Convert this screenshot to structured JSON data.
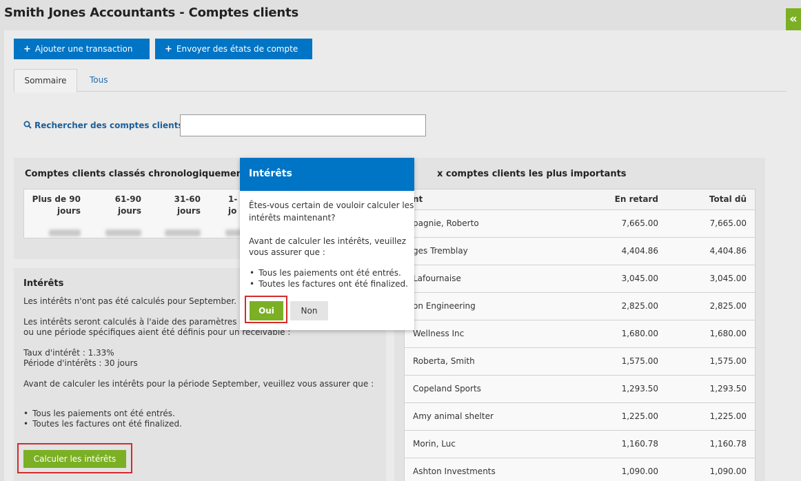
{
  "header": {
    "title": "Smith Jones Accountants - Comptes clients",
    "collapse_icon": "«"
  },
  "toolbar": {
    "add_label": "Ajouter une transaction",
    "send_label": "Envoyer des états de compte",
    "plus": "+"
  },
  "tabs": [
    {
      "label": "Sommaire",
      "active": true
    },
    {
      "label": "Tous",
      "active": false
    }
  ],
  "search": {
    "label": "Rechercher des comptes clients",
    "value": ""
  },
  "aging": {
    "title": "Comptes clients classés chronologiquement",
    "columns": [
      {
        "line1": "Plus de 90",
        "line2": "jours"
      },
      {
        "line1": "61-90",
        "line2": "jours"
      },
      {
        "line1": "31-60",
        "line2": "jours"
      },
      {
        "line1": "1-",
        "line2": "jo"
      }
    ]
  },
  "interest": {
    "title": "Intérêts",
    "line1": "Les intérêts n'ont pas été calculés pour September.",
    "line2": "Les intérêts seront calculés à l'aide des paramètres p",
    "line3": "ou une période spécifiques aient été définis pour un receivable :",
    "rate": "Taux d'intérêt : 1.33%",
    "period": "Période d'intérêts : 30 jours",
    "before": "Avant de calculer les intérêts pour la période September, veuillez vous assurer que :",
    "bullets": [
      "Tous les paiements ont été entrés.",
      "Toutes les factures ont été finalized."
    ],
    "button": "Calculer les intérêts"
  },
  "top": {
    "title": "x comptes clients les plus importants",
    "headers": {
      "name": "nt",
      "overdue": "En retard",
      "total": "Total dû"
    },
    "rows": [
      {
        "name": "pagnie, Roberto",
        "overdue": "7,665.00",
        "total": "7,665.00"
      },
      {
        "name": "ges Tremblay",
        "overdue": "4,404.86",
        "total": "4,404.86"
      },
      {
        "name": "Lafournaise",
        "overdue": "3,045.00",
        "total": "3,045.00"
      },
      {
        "name": "on Engineering",
        "overdue": "2,825.00",
        "total": "2,825.00"
      },
      {
        "name": "Wellness Inc",
        "overdue": "1,680.00",
        "total": "1,680.00"
      },
      {
        "name": "Roberta, Smith",
        "overdue": "1,575.00",
        "total": "1,575.00"
      },
      {
        "name": "Copeland Sports",
        "overdue": "1,293.50",
        "total": "1,293.50"
      },
      {
        "name": "Amy animal shelter",
        "overdue": "1,225.00",
        "total": "1,225.00"
      },
      {
        "name": "Morin, Luc",
        "overdue": "1,160.78",
        "total": "1,160.78"
      },
      {
        "name": "Ashton Investments",
        "overdue": "1,090.00",
        "total": "1,090.00"
      }
    ]
  },
  "modal": {
    "title": "Intérêts",
    "q1": "Êtes-vous certain de vouloir calculer les",
    "q2": "intérêts maintenant?",
    "b1": "Avant de calculer les intérêts, veuillez",
    "b2": "vous assurer que :",
    "bullets": [
      "Tous les paiements ont été entrés.",
      "Toutes les factures ont été finalized."
    ],
    "yes": "Oui",
    "no": "Non"
  },
  "colors": {
    "primary": "#0074c5",
    "accent_green": "#7bb024",
    "highlight_red": "#d42a2a"
  }
}
